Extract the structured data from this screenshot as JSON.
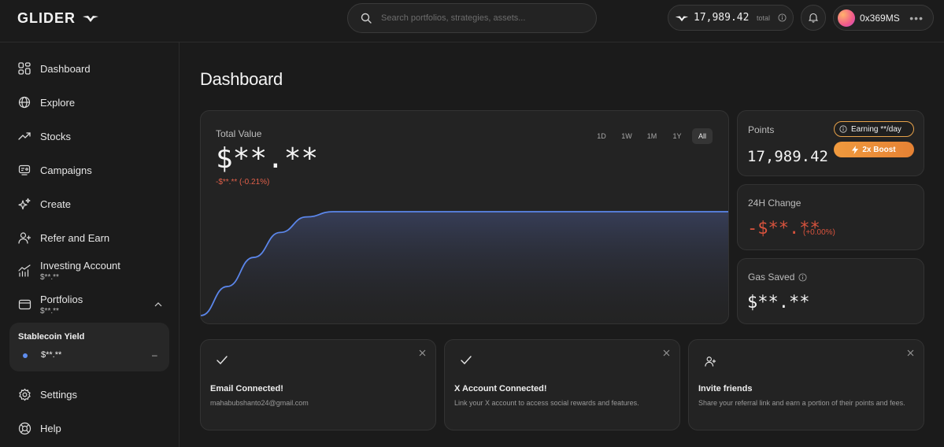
{
  "brand": {
    "name": "GLIDER"
  },
  "header": {
    "search_placeholder": "Search portfolios, strategies, assets...",
    "balance_value": "17,989.42",
    "balance_label": "total",
    "account_name": "0x369MS",
    "more": "•••"
  },
  "sidebar": {
    "items": [
      {
        "label": "Dashboard",
        "icon": "dashboard-icon"
      },
      {
        "label": "Explore",
        "icon": "globe-icon"
      },
      {
        "label": "Stocks",
        "icon": "trend-up-icon"
      },
      {
        "label": "Campaigns",
        "icon": "campaign-icon"
      },
      {
        "label": "Create",
        "icon": "sparkle-icon"
      },
      {
        "label": "Refer and Earn",
        "icon": "user-plus-icon"
      },
      {
        "label": "Investing Account",
        "sub": "$**.**",
        "icon": "chart-bars-icon"
      },
      {
        "label": "Portfolios",
        "sub": "$**.**",
        "icon": "wallet-icon"
      },
      {
        "label": "Settings",
        "icon": "gear-icon"
      },
      {
        "label": "Help",
        "icon": "help-icon"
      }
    ],
    "portfolio_card": {
      "title": "Stablecoin Yield",
      "value": "$**.**"
    }
  },
  "main": {
    "title": "Dashboard",
    "total_value": {
      "label": "Total Value",
      "value": "$**.**",
      "change": "-$**.** (-0.21%)",
      "ranges": [
        "1D",
        "1W",
        "1M",
        "1Y",
        "All"
      ],
      "active_range": "All"
    },
    "points": {
      "label": "Points",
      "value": "17,989.42",
      "earning": "Earning **/day",
      "boost": "2x Boost"
    },
    "change_24h": {
      "label": "24H Change",
      "value": "-$**.**",
      "pct": "(+0.00%)"
    },
    "gas_saved": {
      "label": "Gas Saved",
      "value": "$**.**"
    },
    "cards": [
      {
        "title": "Email Connected!",
        "desc": "mahabubshanto24@gmail.com"
      },
      {
        "title": "X Account Connected!",
        "desc": "Link your X account to access social rewards and features."
      },
      {
        "title": "Invite friends",
        "desc": "Share your referral link and earn a portion of their points and fees."
      }
    ]
  },
  "colors": {
    "accent_line": "#5b86ea",
    "negative": "#d8533d",
    "boost": "#f09a3e"
  },
  "chart_data": {
    "type": "area",
    "x": [
      0,
      5,
      10,
      15,
      20,
      25,
      30,
      35,
      40,
      45,
      50,
      55,
      60,
      65,
      70,
      75,
      80,
      85,
      90,
      95,
      100
    ],
    "series": [
      {
        "values": [
          0,
          28,
          56,
          80,
          95,
          100,
          100,
          100,
          100,
          100,
          100,
          100,
          100,
          100,
          100,
          100,
          100,
          100,
          100,
          100,
          100
        ]
      }
    ],
    "ylim": [
      0,
      100
    ],
    "grid": false
  }
}
